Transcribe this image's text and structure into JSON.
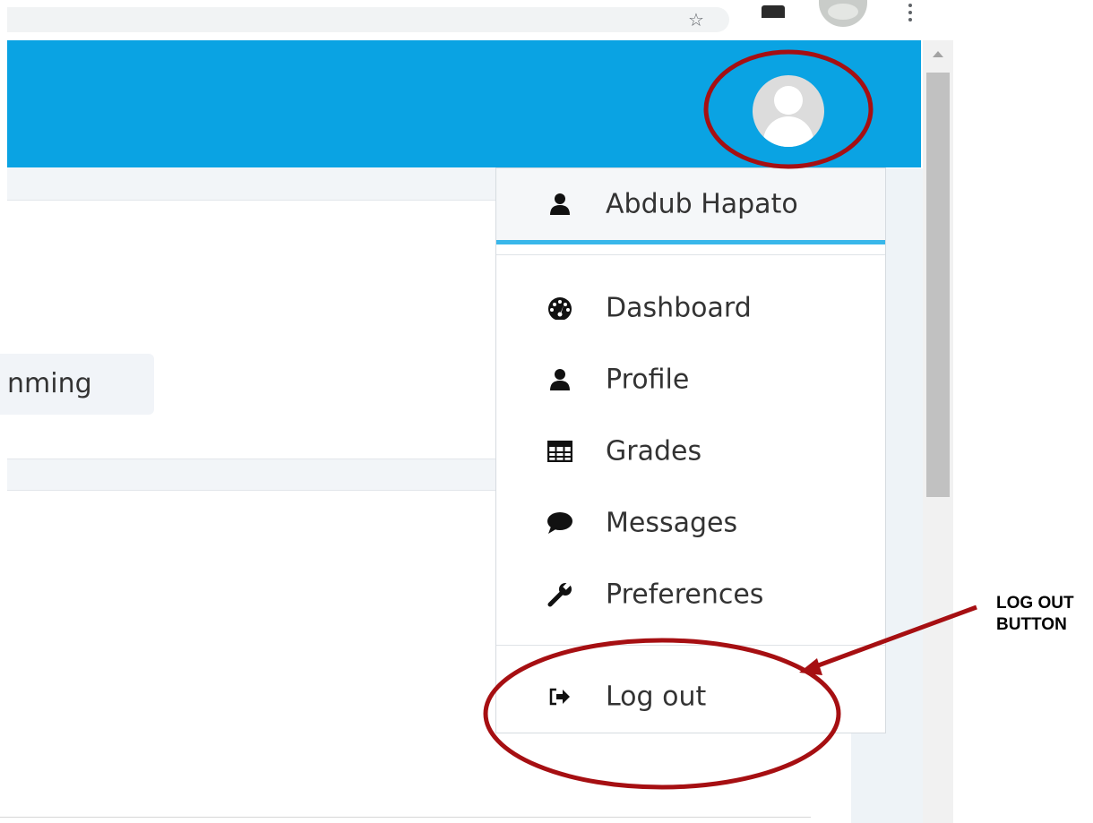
{
  "user_menu": {
    "user_name": "Abdub Hapato",
    "items": [
      {
        "label": "Dashboard",
        "icon": "dashboard-icon"
      },
      {
        "label": "Profile",
        "icon": "user-icon"
      },
      {
        "label": "Grades",
        "icon": "table-icon"
      },
      {
        "label": "Messages",
        "icon": "comment-icon"
      },
      {
        "label": "Preferences",
        "icon": "wrench-icon"
      }
    ],
    "logout_label": "Log out",
    "logout_icon": "sign-out-icon"
  },
  "page": {
    "course_tag_partial": "nming"
  },
  "annotation": {
    "callout_text": "LOG OUT BUTTON",
    "callout_line1": "LOG OUT",
    "callout_line2": "BUTTON",
    "highlight_color": "#a60f12"
  },
  "colors": {
    "navbar": "#0aa3e3",
    "menu_accent": "#39b7ea"
  }
}
